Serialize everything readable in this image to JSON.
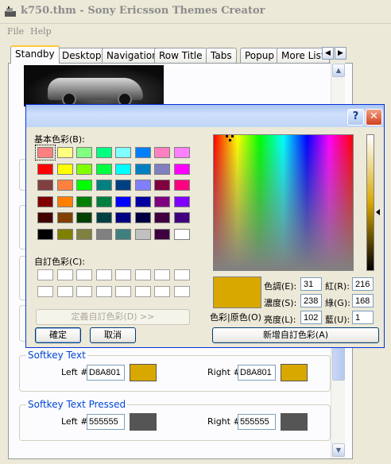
{
  "window": {
    "title": "k750.thm - Sony Ericsson Themes Creator"
  },
  "menu": {
    "file": "File",
    "help": "Help"
  },
  "tabs": [
    {
      "label": "Standby",
      "active": true
    },
    {
      "label": "Desktop"
    },
    {
      "label": "Navigation"
    },
    {
      "label": "Row Title"
    },
    {
      "label": "Tabs"
    },
    {
      "label": "Popup"
    },
    {
      "label": "More List"
    }
  ],
  "groups": [
    {
      "legend": "Softkey Text",
      "left_label": "Left #",
      "left_value": "D8A801",
      "left_color": "#d8a801",
      "right_label": "Right #",
      "right_value": "D8A801",
      "right_color": "#d8a801"
    },
    {
      "legend": "Softkey Text Pressed",
      "left_label": "Left #",
      "left_value": "555555",
      "left_color": "#555555",
      "right_label": "Right #",
      "right_value": "555555",
      "right_color": "#555555"
    }
  ],
  "dialog": {
    "help": "?",
    "close": "✕",
    "basic_colors_label": "基本色彩(B):",
    "custom_colors_label": "自訂色彩(C):",
    "define_custom": "定義自訂色彩(D) >>",
    "ok": "確定",
    "cancel": "取消",
    "color_solid_label": "色彩|原色(O)",
    "add_custom": "新增自訂色彩(A)",
    "hue_label": "色調(E):",
    "hue": "31",
    "sat_label": "濃度(S):",
    "sat": "238",
    "lum_label": "亮度(L):",
    "lum": "102",
    "red_label": "紅(R):",
    "red": "216",
    "green_label": "綠(G):",
    "green": "168",
    "blue_label": "藍(U):",
    "blue": "1",
    "current_color": "#d8a801",
    "basic_colors": [
      "#ff8080",
      "#ffff80",
      "#80ff80",
      "#00ff80",
      "#80ffff",
      "#0080ff",
      "#ff80c0",
      "#ff80ff",
      "#ff0000",
      "#ffff00",
      "#80ff00",
      "#00ff40",
      "#00ffff",
      "#0080c0",
      "#8080c0",
      "#ff00ff",
      "#804040",
      "#ff8040",
      "#00ff00",
      "#008080",
      "#004080",
      "#8080ff",
      "#800040",
      "#ff0080",
      "#800000",
      "#ff8000",
      "#008000",
      "#008040",
      "#0000ff",
      "#0000a0",
      "#800080",
      "#8000ff",
      "#400000",
      "#804000",
      "#004000",
      "#004040",
      "#000080",
      "#000040",
      "#400040",
      "#400080",
      "#000000",
      "#808000",
      "#808040",
      "#808080",
      "#408080",
      "#c0c0c0",
      "#400040",
      "#ffffff"
    ]
  }
}
